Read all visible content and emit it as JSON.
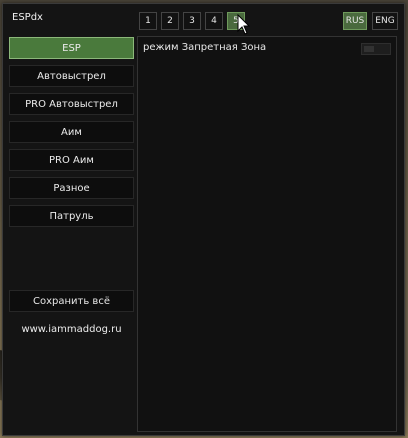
{
  "window": {
    "title": "ESPdx"
  },
  "pages": [
    {
      "label": "1",
      "active": false
    },
    {
      "label": "2",
      "active": false
    },
    {
      "label": "3",
      "active": false
    },
    {
      "label": "4",
      "active": false
    },
    {
      "label": "5",
      "active": true
    }
  ],
  "languages": [
    {
      "label": "RUS",
      "active": true
    },
    {
      "label": "ENG",
      "active": false
    }
  ],
  "sidebar": {
    "items": [
      {
        "label": "ESP",
        "active": true
      },
      {
        "label": "Автовыстрел",
        "active": false
      },
      {
        "label": "PRO Автовыстрел",
        "active": false
      },
      {
        "label": "Аим",
        "active": false
      },
      {
        "label": "PRO Аим",
        "active": false
      },
      {
        "label": "Разное",
        "active": false
      },
      {
        "label": "Патруль",
        "active": false
      }
    ],
    "save_label": "Сохранить всё",
    "website": "www.iammaddog.ru"
  },
  "content": {
    "option_label": "режим Запретная Зона",
    "toggle_state": "off"
  },
  "colors": {
    "accent_active": "#4a7a3c",
    "panel_bg": "#141414"
  }
}
